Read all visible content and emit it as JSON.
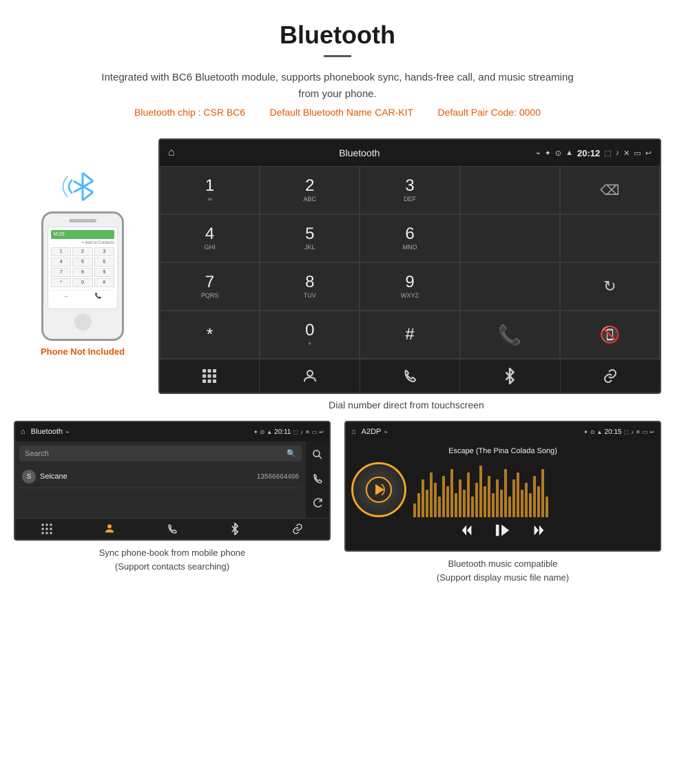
{
  "header": {
    "title": "Bluetooth",
    "description": "Integrated with BC6 Bluetooth module, supports phonebook sync, hands-free call, and music streaming from your phone.",
    "specs": {
      "chip": "Bluetooth chip : CSR BC6",
      "name": "Default Bluetooth Name CAR-KIT",
      "pair": "Default Pair Code: 0000"
    }
  },
  "phone_label": "Phone Not Included",
  "main_screen": {
    "status_bar": {
      "title": "Bluetooth",
      "time": "20:12",
      "usb_icon": "⌁"
    },
    "dialpad": [
      {
        "num": "1",
        "letters": "∞"
      },
      {
        "num": "2",
        "letters": "ABC"
      },
      {
        "num": "3",
        "letters": "DEF"
      },
      {
        "num": "4",
        "letters": "GHI"
      },
      {
        "num": "5",
        "letters": "JKL"
      },
      {
        "num": "6",
        "letters": "MNO"
      },
      {
        "num": "7",
        "letters": "PQRS"
      },
      {
        "num": "8",
        "letters": "TUV"
      },
      {
        "num": "9",
        "letters": "WXYZ"
      },
      {
        "num": "*",
        "letters": ""
      },
      {
        "num": "0",
        "letters": "+"
      },
      {
        "num": "#",
        "letters": ""
      }
    ],
    "caption": "Dial number direct from touchscreen"
  },
  "bottom_left": {
    "status_bar": {
      "title": "Bluetooth",
      "time": "20:11"
    },
    "search_placeholder": "Search",
    "contact": {
      "letter": "S",
      "name": "Seicane",
      "number": "13566664466"
    },
    "caption_line1": "Sync phone-book from mobile phone",
    "caption_line2": "(Support contacts searching)"
  },
  "bottom_right": {
    "status_bar": {
      "title": "A2DP",
      "time": "20:15"
    },
    "song_title": "Escape (The Pina Colada Song)",
    "caption_line1": "Bluetooth music compatible",
    "caption_line2": "(Support display music file name)"
  },
  "icons": {
    "home": "⌂",
    "bluetooth": "✦",
    "back": "↩",
    "search": "🔍",
    "call_green": "📞",
    "hangup_red": "📵",
    "dialpad_grid": "⊞",
    "person": "👤",
    "phone": "📱",
    "reload": "↻",
    "link": "🔗",
    "prev": "⏮",
    "play_pause": "⏯",
    "next": "⏭"
  },
  "music_bars": [
    20,
    35,
    55,
    40,
    65,
    50,
    30,
    60,
    45,
    70,
    35,
    55,
    40,
    65,
    30,
    50,
    75,
    45,
    60,
    35,
    55,
    40,
    70,
    30,
    55,
    65,
    40,
    50,
    35,
    60,
    45,
    70,
    30
  ]
}
